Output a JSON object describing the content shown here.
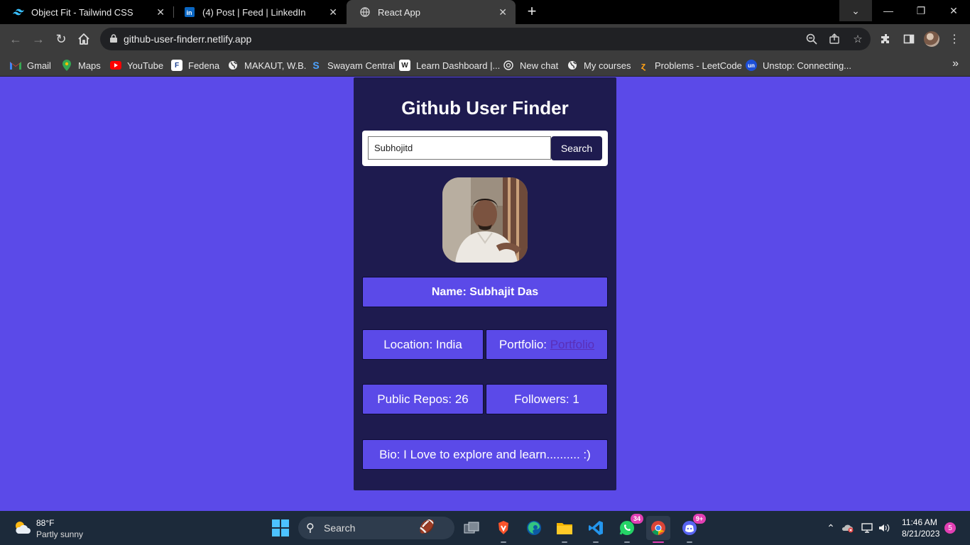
{
  "browser": {
    "tabs": [
      {
        "title": "Object Fit - Tailwind CSS",
        "icon": "tailwind-icon",
        "active": false
      },
      {
        "title": "(4) Post | Feed | LinkedIn",
        "icon": "linkedin-icon",
        "active": false
      },
      {
        "title": "React App",
        "icon": "globe-icon",
        "active": true
      }
    ],
    "url": "github-user-finderr.netlify.app",
    "bookmarks": [
      {
        "label": "Gmail",
        "icon": "gmail-icon"
      },
      {
        "label": "Maps",
        "icon": "maps-icon"
      },
      {
        "label": "YouTube",
        "icon": "youtube-icon"
      },
      {
        "label": "Fedena",
        "icon": "fedena-icon"
      },
      {
        "label": "MAKAUT, W.B.",
        "icon": "globe-icon"
      },
      {
        "label": "Swayam Central",
        "icon": "swayam-icon"
      },
      {
        "label": "Learn Dashboard |...",
        "icon": "learn-icon"
      },
      {
        "label": "New chat",
        "icon": "chatgpt-icon"
      },
      {
        "label": "My courses",
        "icon": "globe-icon"
      },
      {
        "label": "Problems - LeetCode",
        "icon": "leetcode-icon"
      },
      {
        "label": "Unstop: Connecting...",
        "icon": "unstop-icon"
      }
    ]
  },
  "app": {
    "title": "Github User Finder",
    "search": {
      "value": "Subhojitd",
      "button": "Search"
    },
    "user": {
      "name": "Name: Subhajit Das",
      "location": "Location: India",
      "portfolio_prefix": "Portfolio: ",
      "portfolio_link": "Portfolio",
      "public_repos": "Public Repos: 26",
      "followers": "Followers: 1",
      "bio": "Bio: I Love to explore and learn.......... :)"
    }
  },
  "taskbar": {
    "weather": {
      "temp": "88°F",
      "condition": "Partly sunny"
    },
    "search_label": "Search",
    "badges": {
      "whatsapp": "34",
      "discord": "9+"
    },
    "time": "11:46 AM",
    "date": "8/21/2023",
    "notifications": "5"
  }
}
